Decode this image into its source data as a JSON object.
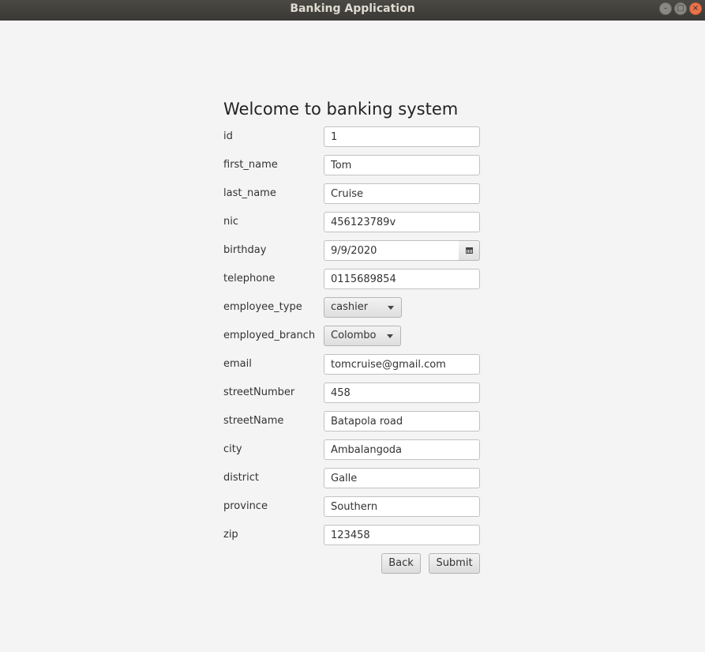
{
  "window": {
    "title": "Banking Application"
  },
  "form": {
    "heading": "Welcome to banking system",
    "fields": [
      {
        "label": "id",
        "value": "1"
      },
      {
        "label": "first_name",
        "value": "Tom"
      },
      {
        "label": "last_name",
        "value": "Cruise"
      },
      {
        "label": "nic",
        "value": "456123789v"
      },
      {
        "label": "birthday",
        "value": "9/9/2020"
      },
      {
        "label": "telephone",
        "value": "0115689854"
      },
      {
        "label": "employee_type",
        "value": "cashier"
      },
      {
        "label": "employed_branch",
        "value": "Colombo"
      },
      {
        "label": "email",
        "value": "tomcruise@gmail.com"
      },
      {
        "label": "streetNumber",
        "value": "458"
      },
      {
        "label": "streetName",
        "value": "Batapola road"
      },
      {
        "label": "city",
        "value": "Ambalangoda"
      },
      {
        "label": "district",
        "value": "Galle"
      },
      {
        "label": "province",
        "value": "Southern"
      },
      {
        "label": "zip",
        "value": "123458"
      }
    ],
    "back_label": "Back",
    "submit_label": "Submit"
  }
}
